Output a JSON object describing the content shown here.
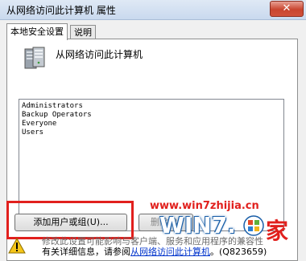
{
  "window": {
    "title": "从网络访问此计算机 属性",
    "close_glyph": "✕"
  },
  "tabs": [
    {
      "label": "本地安全设置",
      "active": true
    },
    {
      "label": "说明",
      "active": false
    }
  ],
  "panel": {
    "policy_title": "从网络访问此计算机",
    "members": [
      "Administrators",
      "Backup Operators",
      "Everyone",
      "Users"
    ],
    "add_button": "添加用户或组(U)...",
    "remove_button": "删除(R)"
  },
  "watermark": {
    "url": "www.win7zhijia.cn",
    "logo_text": "WIN7.",
    "logo_suffix": "家"
  },
  "footer": {
    "line1": "修改此设置可能影响与客户端、服务和应用程序的兼容性",
    "line2_prefix": "有关详细信息，请参阅",
    "line2_link": "从网络访问此计算机",
    "line2_suffix": "。(Q823659)"
  },
  "colors": {
    "highlight": "#e1201d",
    "link": "#0033cc"
  }
}
